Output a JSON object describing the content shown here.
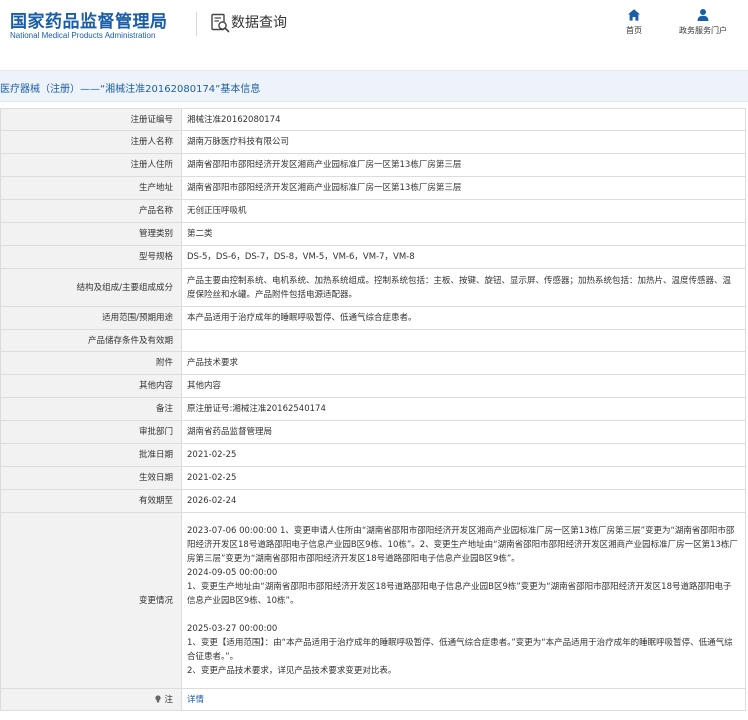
{
  "header": {
    "logo_cn": "国家药品监督管理局",
    "logo_en": "National Medical Products Administration",
    "section_title": "数据查询",
    "nav": [
      {
        "label": "首页",
        "icon": "home-icon"
      },
      {
        "label": "政务服务门户",
        "icon": "user-icon"
      }
    ]
  },
  "title_bar": {
    "text": "医疗器械（注册）——“湘械注准20162080174”基本信息"
  },
  "fields": [
    {
      "label": "注册证编号",
      "value": "湘械注准20162080174"
    },
    {
      "label": "注册人名称",
      "value": "湖南万脉医疗科技有限公司"
    },
    {
      "label": "注册人住所",
      "value": "湖南省邵阳市邵阳经济开发区湘商产业园标准厂房一区第13栋厂房第三层"
    },
    {
      "label": "生产地址",
      "value": "湖南省邵阳市邵阳经济开发区湘商产业园标准厂房一区第13栋厂房第三层"
    },
    {
      "label": "产品名称",
      "value": "无创正压呼吸机"
    },
    {
      "label": "管理类别",
      "value": "第二类"
    },
    {
      "label": "型号规格",
      "value": "DS-5，DS-6，DS-7，DS-8，VM-5，VM-6，VM-7，VM-8"
    },
    {
      "label": "结构及组成/主要组成成分",
      "value": "产品主要由控制系统、电机系统、加热系统组成。控制系统包括：主板、按键、旋钮、显示屏、传感器；加热系统包括：加热片、温度传感器、温度保险丝和水罐。产品附件包括电源适配器。"
    },
    {
      "label": "适用范围/预期用途",
      "value": "本产品适用于治疗成年的睡眠呼吸暂停、低通气综合症患者。"
    },
    {
      "label": "产品储存条件及有效期",
      "value": ""
    },
    {
      "label": "附件",
      "value": "产品技术要求"
    },
    {
      "label": "其他内容",
      "value": "其他内容"
    },
    {
      "label": "备注",
      "value": "原注册证号:湘械注准20162540174"
    },
    {
      "label": "审批部门",
      "value": "湖南省药品监督管理局"
    },
    {
      "label": "批准日期",
      "value": "2021-02-25"
    },
    {
      "label": "生效日期",
      "value": "2021-02-25"
    },
    {
      "label": "有效期至",
      "value": "2026-02-24"
    },
    {
      "label": "变更情况",
      "value": "2023-07-06 00:00:00 1、变更申请人住所由“湖南省邵阳市邵阳经济开发区湘商产业园标准厂房一区第13栋厂房第三层”变更为“湖南省邵阳市邵阳经济开发区18号道路邵阳电子信息产业园B区9栋、10栋”。2、变更生产地址由“湖南省邵阳市邵阳经济开发区湘商产业园标准厂房一区第13栋厂房第三层”变更为“湖南省邵阳市邵阳经济开发区18号道路邵阳电子信息产业园B区9栋”。\n2024-09-05 00:00:00\n1、变更生产地址由“湖南省邵阳市邵阳经济开发区18号道路邵阳电子信息产业园B区9栋”变更为“湖南省邵阳市邵阳经济开发区18号道路邵阳电子信息产业园B区9栋、10栋”。\n\n2025-03-27 00:00:00\n1、变更【适用范围】：由“本产品适用于治疗成年的睡眠呼吸暂停、低通气综合症患者。”变更为“本产品适用于治疗成年的睡眠呼吸暂停、低通气综合征患者。”。\n2、变更产品技术要求，详见产品技术要求变更对比表。"
    }
  ],
  "note": {
    "label": "注",
    "link": "详情"
  }
}
